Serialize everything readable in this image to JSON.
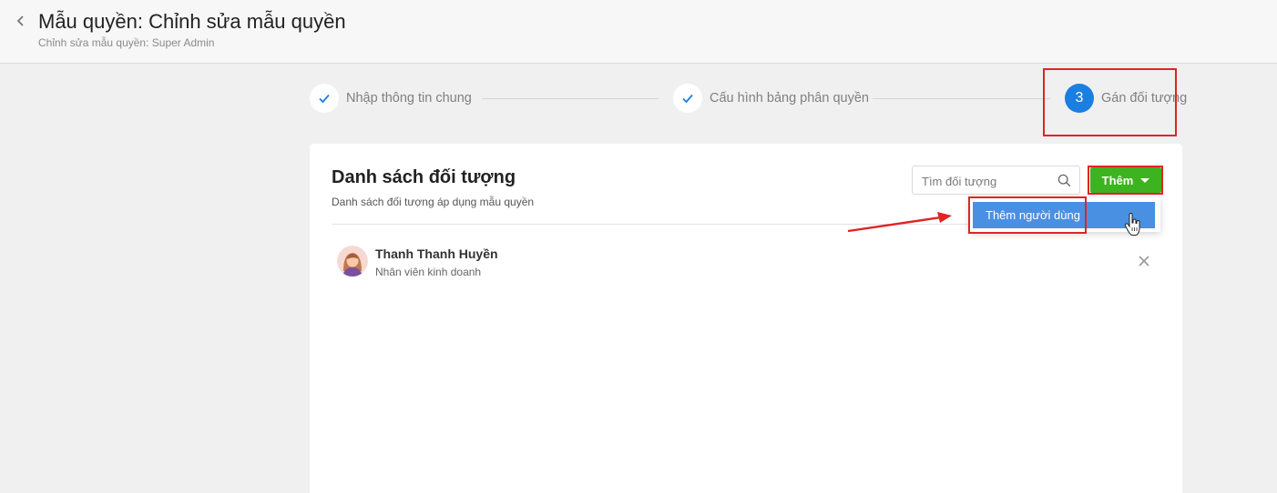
{
  "header": {
    "title": "Mẫu quyền: Chỉnh sửa mẫu quyền",
    "subtitle": "Chỉnh sửa mẫu quyền: Super Admin"
  },
  "steps": [
    {
      "label": "Nhập thông tin chung",
      "status": "done",
      "icon": "check-icon"
    },
    {
      "label": "Cấu hình bảng phân quyền",
      "status": "done",
      "icon": "check-icon"
    },
    {
      "label": "Gán đối tượng",
      "status": "active",
      "number": "3"
    }
  ],
  "card": {
    "title": "Danh sách đối tượng",
    "subtitle": "Danh sách đối tượng áp dụng mẫu quyền",
    "search_placeholder": "Tìm đối tượng",
    "add_button_label": "Thêm",
    "dropdown_items": [
      "Thêm người dùng"
    ]
  },
  "users": [
    {
      "name": "Thanh Thanh Huyền",
      "role": "Nhân viên kinh doanh"
    }
  ],
  "colors": {
    "accent_blue": "#1a7fe0",
    "add_green": "#3db31f",
    "highlight_red": "#e02424",
    "dropdown_blue": "#4a90e2"
  }
}
